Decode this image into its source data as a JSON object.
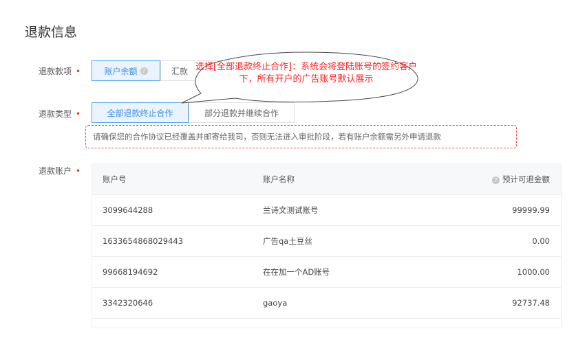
{
  "title": "退款信息",
  "refund_item": {
    "label": "退款款项",
    "options": [
      "账户余额",
      "汇款"
    ]
  },
  "refund_type": {
    "label": "退款类型",
    "options": [
      "全部退款终止合作",
      "部分退款并继续合作"
    ]
  },
  "warning": "请确保您的合作协议已经覆盖并邮寄给我司，否则无法进入审批阶段，若有账户余额需另外申请退款",
  "refund_accounts": {
    "label": "退款账户",
    "columns": [
      "账户号",
      "账户名称",
      "预计可退金额"
    ],
    "rows": [
      {
        "id": "3099644288",
        "name": "兰诗文测试账号",
        "amount": "99999.99"
      },
      {
        "id": "1633654868029443",
        "name": "广告qa土豆丝",
        "amount": "0.00"
      },
      {
        "id": "99668194692",
        "name": "在在加一个AD账号",
        "amount": "1000.00"
      },
      {
        "id": "3342320646",
        "name": "gaoya",
        "amount": "92737.48"
      }
    ]
  },
  "callout": "选择[全部退款终止合作]：系统会将登陆账号的签约客户下，所有开户的广告账号默认展示",
  "required_mark": "•",
  "help_mark": "?"
}
